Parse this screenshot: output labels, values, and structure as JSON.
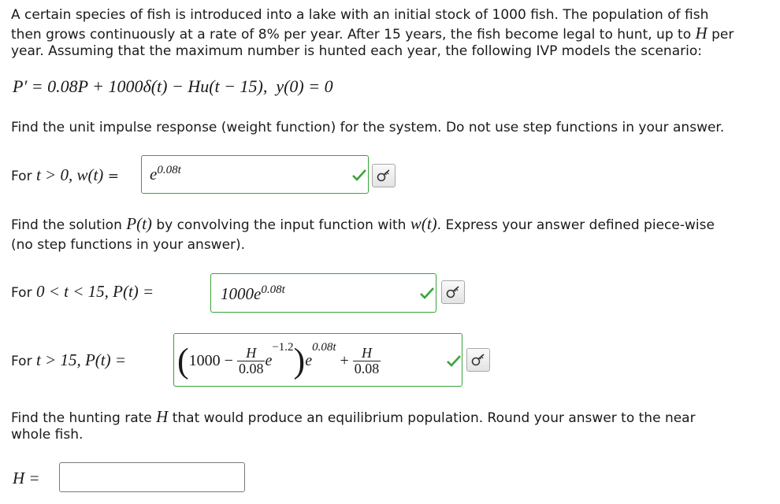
{
  "intro": {
    "line1": "A certain species of fish is introduced into a lake with an initial stock of 1000 fish. The population of fish",
    "line2a": "then grows continuously at a rate of 8% per year. After 15 years, the fish become legal to hunt, up to",
    "line2_var": "H",
    "line2b": "per",
    "line3": "year. Assuming that the maximum number is hunted each year, the following IVP models the scenario:"
  },
  "ivp": {
    "lhs": "P′ = 0.08P + 1000δ(t) − Hu(t − 15),",
    "ic": "y(0) = 0"
  },
  "part1": {
    "question": "Find the unit impulse response (weight function) for the system. Do not use step functions in your answer.",
    "label": "For",
    "cond": "t > 0,  w(t)",
    "eq": "=",
    "answer_base": "e",
    "answer_exp": "0.08t"
  },
  "part2": {
    "question_a": "Find the solution",
    "question_b": "by convolving the input function with",
    "question_c": ". Express your answer defined piece-wise",
    "question_d": "(no step functions in your answer).",
    "p_of_t": "P(t)",
    "w_of_t": "w(t)",
    "row1_label": "For",
    "row1_cond": "0 < t < 15,  P(t) =",
    "row1_answer_coef": "1000e",
    "row1_answer_exp": "0.08t",
    "row2_label": "For",
    "row2_cond": "t > 15,  P(t) =",
    "row2_a": "1000 −",
    "row2_frac_num": "H",
    "row2_frac_den": "0.08",
    "row2_e": "e",
    "row2_e_exp": "−1.2",
    "row2_b": "e",
    "row2_b_exp": "0.08t",
    "row2_plus": "+",
    "row2_frac2_num": "H",
    "row2_frac2_den": "0.08"
  },
  "part3": {
    "question_a": "Find the hunting rate",
    "var": "H",
    "question_b": "that would produce an equilibrium population. Round your answer to the near",
    "question_c": "whole fish.",
    "label": "H =",
    "value": ""
  },
  "colors": {
    "correct": "#3aa33a",
    "border": "#7a7a7a"
  },
  "icons": {
    "check": "check-icon",
    "key": "key-icon"
  }
}
